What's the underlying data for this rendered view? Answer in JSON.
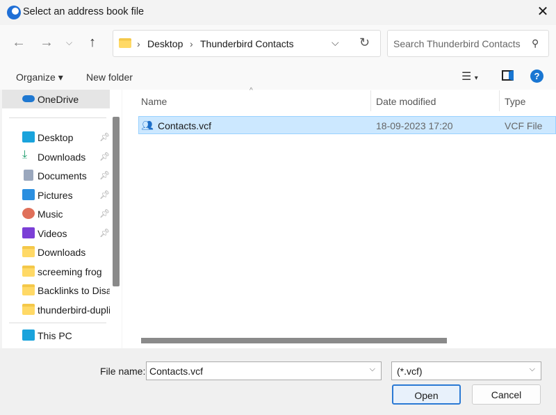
{
  "window": {
    "title": "Select an address book file"
  },
  "breadcrumb": [
    "Desktop",
    "Thunderbird Contacts"
  ],
  "search": {
    "placeholder": "Search Thunderbird Contacts"
  },
  "toolbar": {
    "organize": "Organize",
    "new_folder": "New folder"
  },
  "sidebar": {
    "onedrive": "OneDrive",
    "items": [
      {
        "label": "Desktop",
        "pinned": true
      },
      {
        "label": "Downloads",
        "pinned": true
      },
      {
        "label": "Documents",
        "pinned": true
      },
      {
        "label": "Pictures",
        "pinned": true
      },
      {
        "label": "Music",
        "pinned": true
      },
      {
        "label": "Videos",
        "pinned": true
      },
      {
        "label": "Downloads"
      },
      {
        "label": "screeming frog"
      },
      {
        "label": "Backlinks to Disavow"
      },
      {
        "label": "thunderbird-duplicates"
      }
    ],
    "this_pc": "This PC"
  },
  "columns": {
    "name": "Name",
    "date": "Date modified",
    "type": "Type"
  },
  "files": [
    {
      "name": "Contacts.vcf",
      "date": "18-09-2023 17:20",
      "type": "VCF File"
    }
  ],
  "footer": {
    "file_name_label": "File name:",
    "file_name_value": "Contacts.vcf",
    "file_type": "(*.vcf)",
    "open": "Open",
    "cancel": "Cancel"
  }
}
